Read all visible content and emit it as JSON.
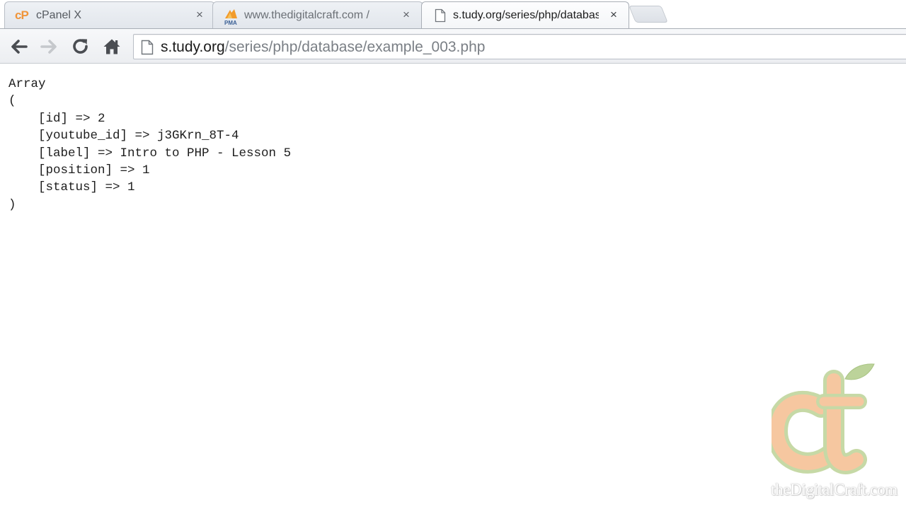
{
  "tabs": [
    {
      "title": "cPanel X",
      "favicon": "cpanel-icon",
      "close": "×",
      "active": false
    },
    {
      "title": "www.thedigitalcraft.com / ",
      "favicon": "phpmyadmin-icon",
      "close": "×",
      "active": false
    },
    {
      "title": "s.tudy.org/series/php/database",
      "favicon": "page-icon",
      "close": "×",
      "active": true
    }
  ],
  "favicons": {
    "cpanel": "cP",
    "pma": "PMA"
  },
  "toolbar": {
    "back_icon": "back-arrow-icon",
    "forward_icon": "forward-arrow-icon",
    "reload_icon": "reload-icon",
    "home_icon": "home-icon"
  },
  "address": {
    "host": "s.tudy.org",
    "path": "/series/php/database/example_003.php"
  },
  "output": "Array\n(\n    [id] => 2\n    [youtube_id] => j3GKrn_8T-4\n    [label] => Intro to PHP - Lesson 5\n    [position] => 1\n    [status] => 1\n)",
  "watermark": {
    "text": "theDigitalCraft.com",
    "logo_icon": "thedigitalcraft-logo"
  },
  "colors": {
    "cpanel_orange": "#f0953a",
    "logo_orange": "#f6c7a0",
    "logo_green": "#bcd39a"
  }
}
